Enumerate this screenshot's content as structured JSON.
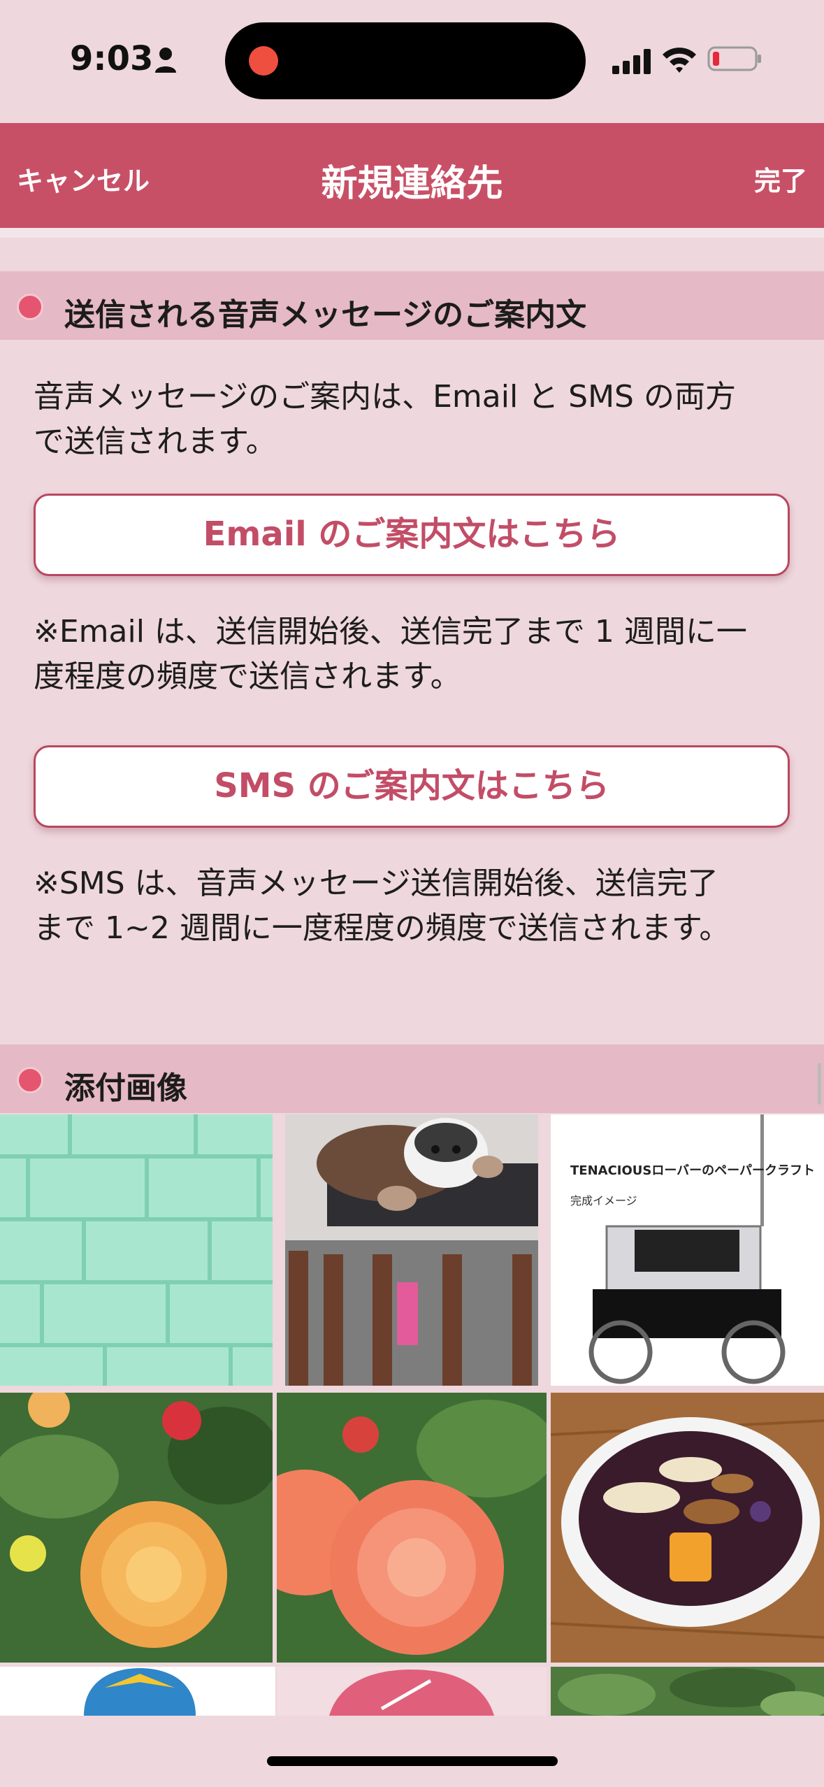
{
  "status_bar": {
    "time": "9:03",
    "icons": [
      "person-icon",
      "signal-icon",
      "wifi-icon",
      "battery-icon"
    ],
    "battery_level": 0.1,
    "recording_indicator_color": "#ef4f3f"
  },
  "nav": {
    "cancel_label": "キャンセル",
    "title": "新規連絡先",
    "done_label": "完了",
    "bar_color": "#c85066"
  },
  "voice_section": {
    "title": "送信される音声メッセージのご案内文",
    "intro_line1": "音声メッセージのご案内は、Email と SMS の両方",
    "intro_line2": "で送信されます。",
    "email_button_label": "Email のご案内文はこちら",
    "email_note_line1": "※Email は、送信開始後、送信完了まで 1 週間に一",
    "email_note_line2": "度程度の頻度で送信されます。",
    "sms_button_label": "SMS のご案内文はこちら",
    "sms_note_line1": "※SMS は、音声メッセージ送信開始後、送信完了",
    "sms_note_line2": "まで 1~2 週間に一度程度の頻度で送信されます。"
  },
  "attachment_section": {
    "title": "添付画像",
    "tiles": [
      {
        "kind": "mint-brick-wall-photo"
      },
      {
        "kind": "jumping-husky-photo"
      },
      {
        "kind": "rover-papercraft-photo",
        "caption": "TENACIOUSローバーのペーパークラフト",
        "subcaption": "完成イメージ"
      },
      {
        "kind": "orange-dahlia-photo"
      },
      {
        "kind": "salmon-dahlia-photo"
      },
      {
        "kind": "acai-bowl-photo"
      },
      {
        "kind": "cartoon-character-partial"
      },
      {
        "kind": "pink-circle-logo-partial"
      },
      {
        "kind": "leaves-partial"
      }
    ]
  },
  "colors": {
    "background": "#eed7dd",
    "section_header": "#e5b9c5",
    "accent": "#c24d67",
    "bullet": "#e6556f"
  }
}
